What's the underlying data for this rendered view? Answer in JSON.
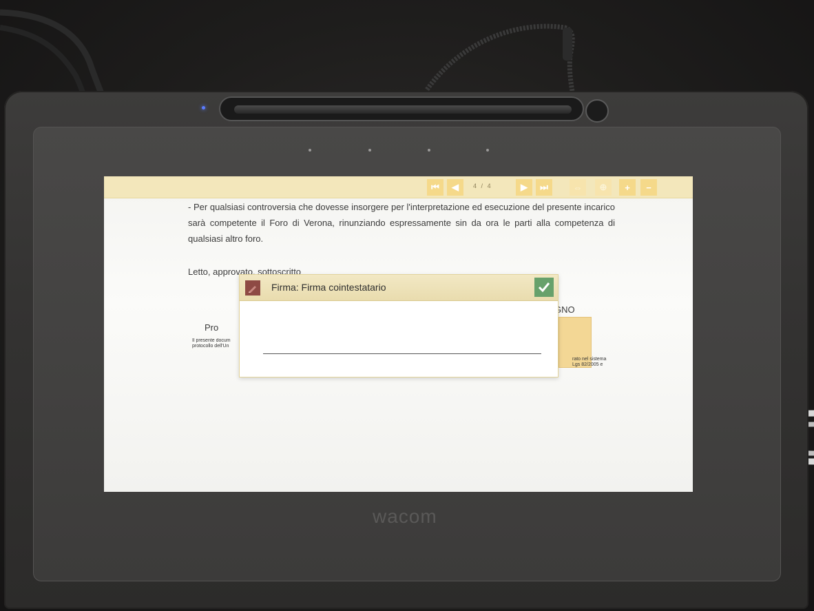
{
  "device": {
    "brand": "wacom"
  },
  "toolbar": {
    "first_icon": "⏮",
    "prev_icon": "◀",
    "page_current": "4",
    "page_sep": "/",
    "page_total": "4",
    "next_icon": "▶",
    "last_icon": "⏭",
    "zoom_in_icon": "+",
    "zoom_out_icon": "−"
  },
  "document": {
    "paragraph": "- Per qualsiasi controversia che dovesse insorgere per l'interpretazione ed esecuzione del presente incarico sarà competente il Foro di Verona, rinunziando espressamente sin da ora le parti alla competenza di qualsiasi altro foro.",
    "closing": "Letto, approvato, sottoscritto",
    "left_label": "Pro",
    "left_small_1": "Il presente docum",
    "left_small_2": "protocollo dell'Un",
    "right_label": "GNO",
    "right_small_1": "rato nel sistema",
    "right_small_2": "Lgs 82/2005 e"
  },
  "dialog": {
    "title": "Firma: Firma cointestatario"
  },
  "colors": {
    "toolbar_bg": "#f3e7bb",
    "button": "#f5d98a",
    "ok_button": "#67a16b",
    "dialog_icon": "#8e4a44"
  }
}
